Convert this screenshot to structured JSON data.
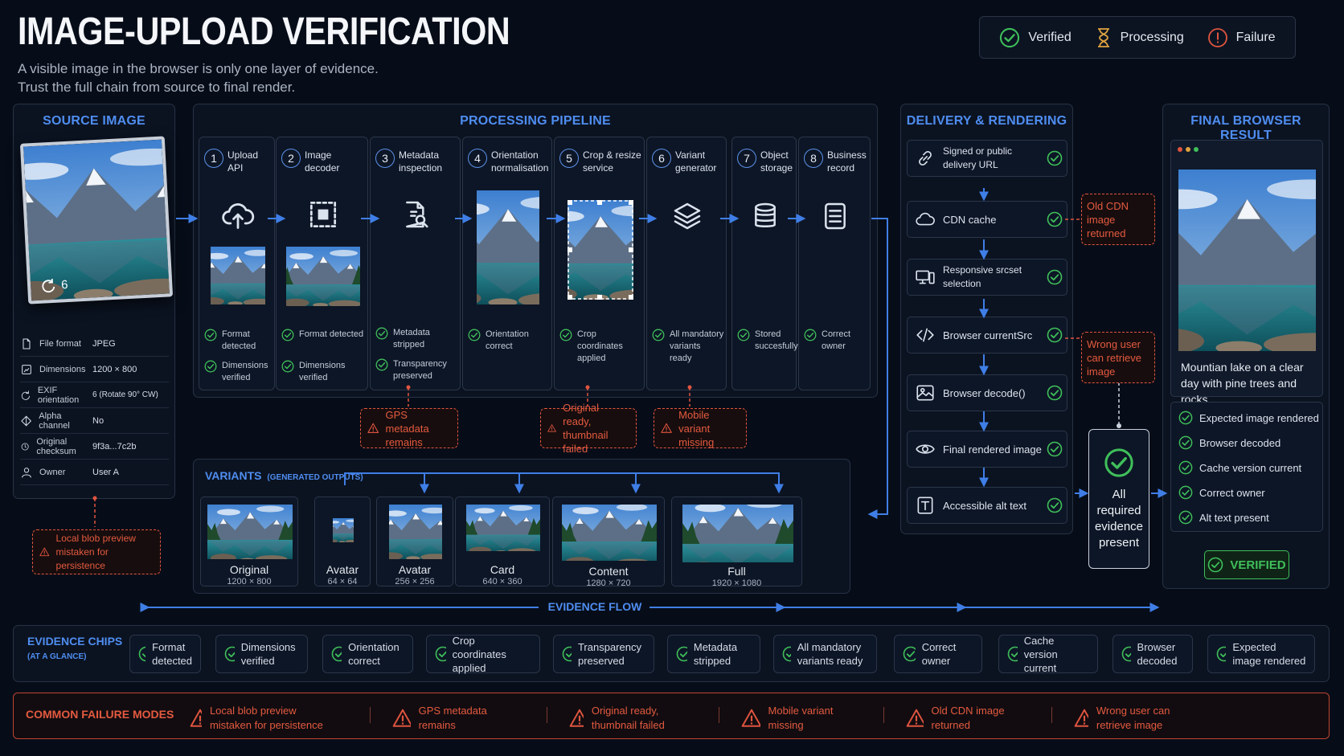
{
  "header": {
    "title": "IMAGE-UPLOAD VERIFICATION",
    "subtitle_line1": "A visible image in the browser is only one layer of evidence.",
    "subtitle_line2": "Trust the full chain from source to final render."
  },
  "legend": {
    "verified": "Verified",
    "processing": "Processing",
    "failure": "Failure"
  },
  "colors": {
    "accent": "#4f8df0",
    "verified": "#3fbf5a",
    "failure": "#e0553f",
    "background": "#070d18"
  },
  "source": {
    "title": "SOURCE IMAGE",
    "rotation_badge": "6",
    "rows": [
      {
        "icon": "file-icon",
        "key": "File format",
        "value": "JPEG"
      },
      {
        "icon": "dimensions-icon",
        "key": "Dimensions",
        "value": "1200 × 800"
      },
      {
        "icon": "rotate-icon",
        "key": "EXIF orientation",
        "value": "6 (Rotate 90° CW)"
      },
      {
        "icon": "alpha-icon",
        "key": "Alpha channel",
        "value": "No"
      },
      {
        "icon": "clock-icon",
        "key": "Original checksum",
        "value": "9f3a...7c2b"
      },
      {
        "icon": "user-icon",
        "key": "Owner",
        "value": "User A"
      }
    ],
    "failure": "Local blob preview mistaken for persistence"
  },
  "pipeline": {
    "title": "PROCESSING PIPELINE",
    "stages": [
      {
        "num": "1",
        "label": "Upload API",
        "icon": "upload-cloud-icon",
        "checks": [
          "Format detected",
          "Dimensions verified"
        ]
      },
      {
        "num": "2",
        "label": "Image decoder",
        "icon": "decoder-icon",
        "checks": [
          "Format detected",
          "Dimensions verified"
        ]
      },
      {
        "num": "3",
        "label": "Metadata inspection",
        "icon": "document-search-icon",
        "checks": [
          "Metadata stripped",
          "Transparency preserved"
        ]
      },
      {
        "num": "4",
        "label": "Orientation normalisation",
        "icon": "image-icon",
        "checks": [
          "Orientation correct"
        ]
      },
      {
        "num": "5",
        "label": "Crop & resize service",
        "icon": "crop-icon",
        "checks": [
          "Crop coordinates applied"
        ]
      },
      {
        "num": "6",
        "label": "Variant generator",
        "icon": "layers-icon",
        "checks": [
          "All mandatory variants ready"
        ]
      },
      {
        "num": "7",
        "label": "Object storage",
        "icon": "database-icon",
        "checks": [
          "Stored succesfully"
        ]
      },
      {
        "num": "8",
        "label": "Business record",
        "icon": "list-icon",
        "checks": [
          "Correct owner"
        ]
      }
    ],
    "failures": [
      "GPS metadata remains",
      "Original ready, thumbnail failed",
      "Mobile variant missing"
    ]
  },
  "variants": {
    "title": "VARIANTS",
    "subtitle": "(GENERATED OUTPUTS)",
    "items": [
      {
        "name": "Original",
        "dims": "1200 × 800"
      },
      {
        "name": "Avatar",
        "dims": "64 × 64"
      },
      {
        "name": "Avatar",
        "dims": "256 × 256"
      },
      {
        "name": "Card",
        "dims": "640 × 360"
      },
      {
        "name": "Content",
        "dims": "1280 × 720"
      },
      {
        "name": "Full",
        "dims": "1920 × 1080"
      }
    ]
  },
  "delivery": {
    "title": "DELIVERY & RENDERING",
    "steps": [
      {
        "icon": "link-icon",
        "label": "Signed or public delivery URL"
      },
      {
        "icon": "cloud-icon",
        "label": "CDN cache"
      },
      {
        "icon": "devices-icon",
        "label": "Responsive srcset selection"
      },
      {
        "icon": "code-icon",
        "label": "Browser currentSrc"
      },
      {
        "icon": "picture-icon",
        "label": "Browser decode()"
      },
      {
        "icon": "eye-icon",
        "label": "Final rendered image"
      },
      {
        "icon": "text-icon",
        "label": "Accessible alt text"
      }
    ],
    "failures": [
      "Old CDN image returned",
      "Wrong user can retrieve image"
    ],
    "evidence_box": "All required evidence present"
  },
  "final": {
    "title": "FINAL BROWSER RESULT",
    "caption": "Mountian lake on a clear day with pine trees and rocks.",
    "checks": [
      "Expected image rendered",
      "Browser decoded",
      "Cache version current",
      "Correct owner",
      "Alt text present"
    ],
    "badge": "VERIFIED"
  },
  "evidence_flow": "EVIDENCE FLOW",
  "chips": {
    "title": "EVIDENCE CHIPS",
    "subtitle": "(AT A GLANCE)",
    "items": [
      "Format detected",
      "Dimensions verified",
      "Orientation correct",
      "Crop coordinates applied",
      "Transparency preserved",
      "Metadata stripped",
      "All mandatory variants ready",
      "Correct owner",
      "Cache version current",
      "Browser decoded",
      "Expected image rendered"
    ]
  },
  "failure_modes": {
    "title": "COMMON FAILURE MODES",
    "items": [
      "Local blob preview mistaken for persistence",
      "GPS metadata remains",
      "Original ready, thumbnail failed",
      "Mobile variant missing",
      "Old CDN image returned",
      "Wrong user can retrieve image"
    ]
  }
}
